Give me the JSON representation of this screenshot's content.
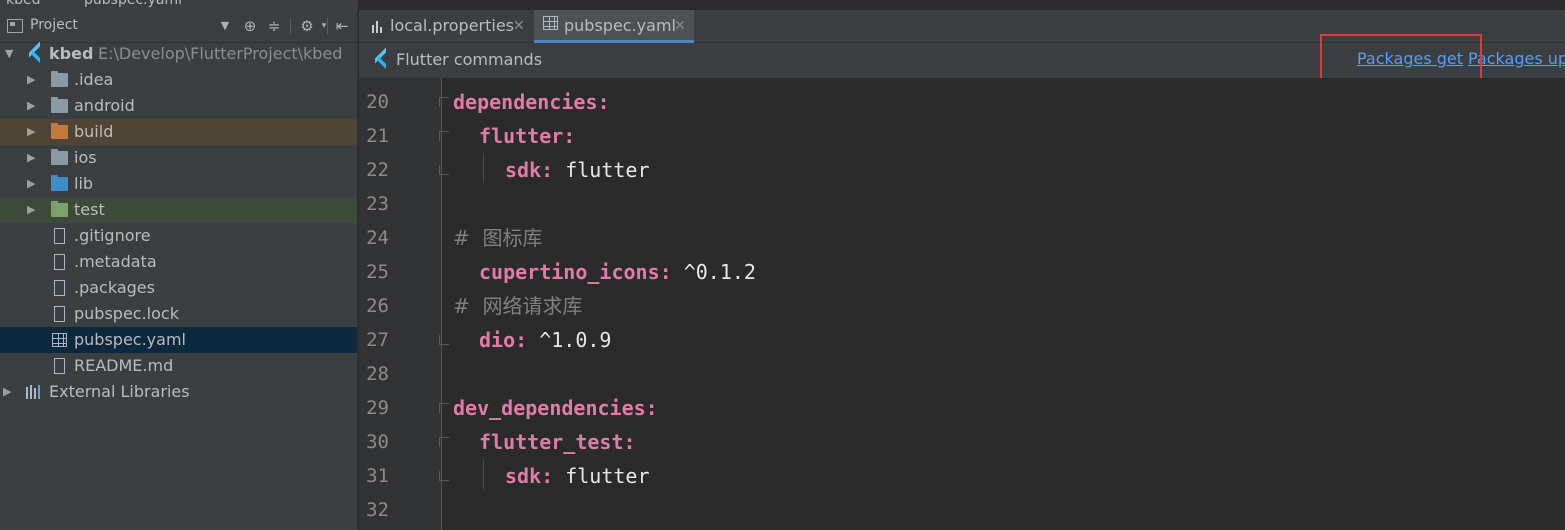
{
  "breadcrumb": {
    "project": "kbed",
    "file": "pubspec.yaml"
  },
  "project_panel": {
    "title": "Project",
    "root": {
      "name": "kbed",
      "path": "E:\\Develop\\FlutterProject\\kbed"
    },
    "items": [
      {
        "label": ".idea",
        "kind": "folder"
      },
      {
        "label": "android",
        "kind": "folder"
      },
      {
        "label": "build",
        "kind": "folder-excluded"
      },
      {
        "label": "ios",
        "kind": "folder"
      },
      {
        "label": "lib",
        "kind": "folder-source"
      },
      {
        "label": "test",
        "kind": "folder-test"
      },
      {
        "label": ".gitignore",
        "kind": "file"
      },
      {
        "label": ".metadata",
        "kind": "file"
      },
      {
        "label": ".packages",
        "kind": "file"
      },
      {
        "label": "pubspec.lock",
        "kind": "file"
      },
      {
        "label": "pubspec.yaml",
        "kind": "yaml",
        "selected": true
      },
      {
        "label": "README.md",
        "kind": "file"
      }
    ],
    "external": "External Libraries"
  },
  "tabs": [
    {
      "label": "local.properties",
      "active": false
    },
    {
      "label": "pubspec.yaml",
      "active": true
    }
  ],
  "flutter_bar": {
    "label": "Flutter commands",
    "packages_get": "Packages get",
    "packages_upgrade": "Packages up"
  },
  "code": [
    {
      "num": "20",
      "key": "dependencies:",
      "val": "",
      "comment": ""
    },
    {
      "num": "21",
      "key": "flutter:",
      "val": "",
      "comment": ""
    },
    {
      "num": "22",
      "key": "sdk:",
      "val": " flutter",
      "comment": ""
    },
    {
      "num": "23",
      "key": "",
      "val": "",
      "comment": ""
    },
    {
      "num": "24",
      "key": "",
      "val": "",
      "comment": "#  图标库"
    },
    {
      "num": "25",
      "key": "cupertino_icons:",
      "val": " ^0.1.2",
      "comment": ""
    },
    {
      "num": "26",
      "key": "",
      "val": "",
      "comment": "#  网络请求库"
    },
    {
      "num": "27",
      "key": "dio:",
      "val": " ^1.0.9",
      "comment": ""
    },
    {
      "num": "28",
      "key": "",
      "val": "",
      "comment": ""
    },
    {
      "num": "29",
      "key": "dev_dependencies:",
      "val": "",
      "comment": ""
    },
    {
      "num": "30",
      "key": "flutter_test:",
      "val": "",
      "comment": ""
    },
    {
      "num": "31",
      "key": "sdk:",
      "val": " flutter",
      "comment": ""
    },
    {
      "num": "32",
      "key": "",
      "val": "",
      "comment": ""
    }
  ],
  "colors": {
    "accent": "#4a88c7",
    "link": "#589df6",
    "highlight": "#e53935",
    "yaml_key": "#e37ba8"
  }
}
